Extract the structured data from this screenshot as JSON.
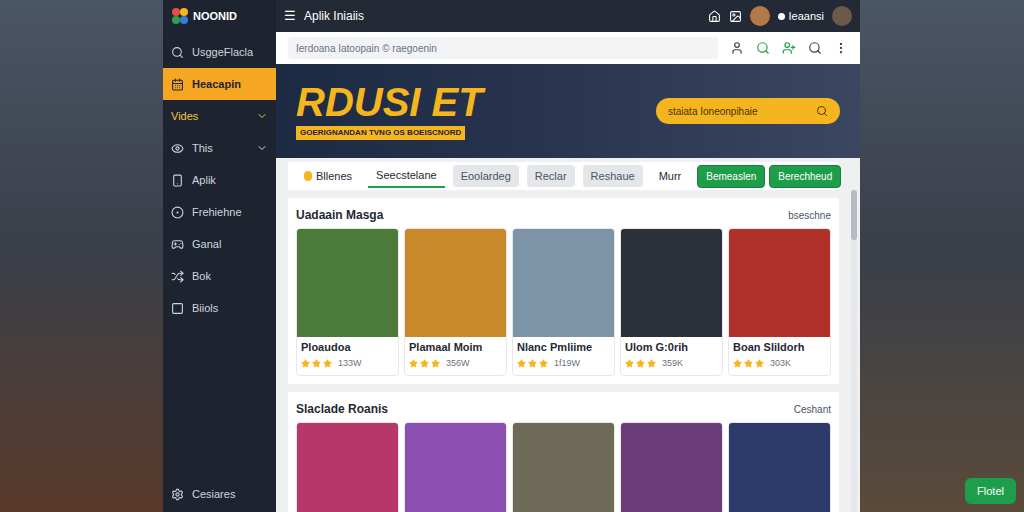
{
  "app": {
    "logo": "NOONID",
    "menu_icon": "☰",
    "title": "Aplik Iniaiis",
    "user": "Ieaansi"
  },
  "sidebar": {
    "items": [
      {
        "label": "UsggeFlacla",
        "selected": false,
        "expandable": false,
        "expanded": false
      },
      {
        "label": "Heacapin",
        "selected": true,
        "expandable": false,
        "expanded": false
      },
      {
        "label": "Vides",
        "selected": false,
        "expandable": true,
        "expanded": true
      },
      {
        "label": "This",
        "selected": false,
        "expandable": true,
        "expanded": false
      },
      {
        "label": "Aplik",
        "selected": false,
        "expandable": false,
        "expanded": false
      },
      {
        "label": "Frehiehne",
        "selected": false,
        "expandable": false,
        "expanded": false
      },
      {
        "label": "Ganal",
        "selected": false,
        "expandable": false,
        "expanded": false
      },
      {
        "label": "Bok",
        "selected": false,
        "expandable": false,
        "expanded": false
      },
      {
        "label": "Biiols",
        "selected": false,
        "expandable": false,
        "expanded": false
      }
    ],
    "footer": "Cesiares"
  },
  "search": {
    "placeholder": "Ierdoana Iatoopain © raegoenin"
  },
  "banner": {
    "title": "RDUSI ET",
    "subtitle": "GOERIGNANDAN TVNG OS BOEISCNORD",
    "search_placeholder": "staiata Ioneonpihaie"
  },
  "tabs": [
    {
      "label": "Bllenes",
      "selected": false,
      "kind": "icon"
    },
    {
      "label": "Seecstelane",
      "selected": true,
      "kind": "plain"
    },
    {
      "label": "Eoolardeg",
      "selected": false,
      "kind": "pill"
    },
    {
      "label": "Reclar",
      "selected": false,
      "kind": "pill"
    },
    {
      "label": "Reshaue",
      "selected": false,
      "kind": "pill"
    },
    {
      "label": "Murr",
      "selected": false,
      "kind": "plain"
    }
  ],
  "actions": [
    "Bemeaslen",
    "Berechheud"
  ],
  "sections": [
    {
      "title": "Uadaain Masga",
      "link": "bseschne",
      "cards": [
        {
          "title": "Ploaudoa",
          "stars": 3,
          "count": "133W",
          "color": "#4b7a3a"
        },
        {
          "title": "Plamaal Moim",
          "stars": 3,
          "count": "356W",
          "color": "#c9892b"
        },
        {
          "title": "Nlanc Pmliime",
          "stars": 3,
          "count": "1f19W",
          "color": "#7d93a8"
        },
        {
          "title": "Ulom G:0rih",
          "stars": 3,
          "count": "359K",
          "color": "#2c3038"
        },
        {
          "title": "Boan Slildorh",
          "stars": 3,
          "count": "303K",
          "color": "#b0302a"
        }
      ]
    },
    {
      "title": "Slaclade Roanis",
      "link": "Ceshant",
      "cards": [
        {
          "color": "#b7376b"
        },
        {
          "color": "#8a4fb0"
        },
        {
          "color": "#6d6a58"
        },
        {
          "color": "#6a3d7a"
        },
        {
          "color": "#2d3b6b"
        }
      ]
    }
  ],
  "float_button": "Flotel"
}
